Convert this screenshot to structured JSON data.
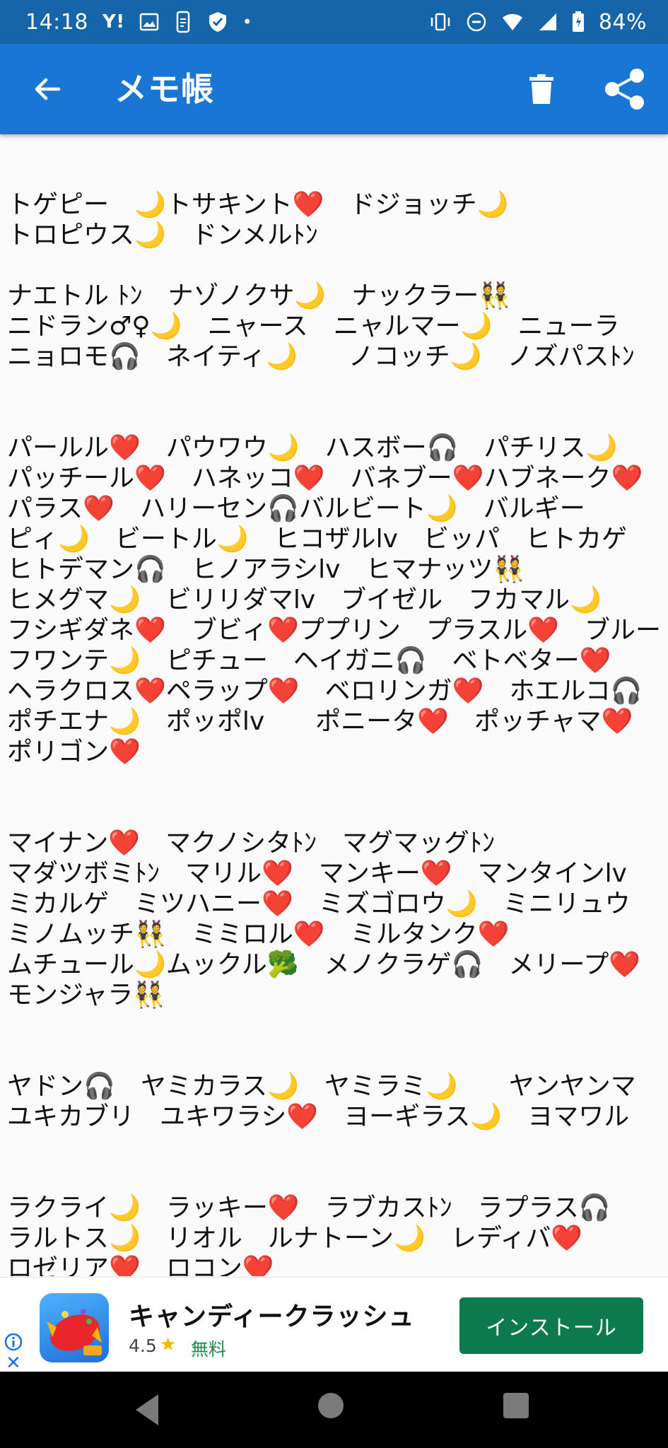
{
  "status_bar": {
    "time": "14:18",
    "yahoo": "Y!",
    "dot": "•",
    "battery": "84%"
  },
  "app_bar": {
    "title": "メモ帳"
  },
  "memo": {
    "text": "トゲピー　🌙トサキント❤️　ドジョッチ🌙\nトロピウス🌙　ドンメルﾄﾝ\n\nナエトル ﾄﾝ　ナゾノクサ🌙　ナックラー👯\nニドラン♂♀🌙　ニャース　ニャルマー🌙　ニューラ\nニョロモ🎧　ネイティ🌙　　ノコッチ🌙　ノズパスﾄﾝ\n\n\nパールル❤️　パウワウ🌙　ハスボー🎧　パチリス🌙\nパッチール❤️　ハネッコ❤️　バネブー❤️ハブネーク❤️\nパラス❤️　ハリーセン🎧バルビート🌙　バルギー\nピィ🌙　ビートル🌙　ヒコザルlv　ビッパ　ヒトカゲ\nヒトデマン🎧　ヒノアラシlv　ヒマナッツ👯\nヒメグマ🌙　ビリリダマlv　ブイゼル　フカマル🌙\nフシギダネ❤️　ブビィ❤️ププリン　プラスル❤️　ブルー\nフワンテ🌙　ピチュー　ヘイガニ🎧　ベトベター❤️\nヘラクロス❤️ペラップ❤️　ベロリンガ❤️　ホエルコ🎧\nポチエナ🌙　ポッポlv　　ポニータ❤️　ポッチャマ❤️\nポリゴン❤️\n\n\nマイナン❤️　マクノシタﾄﾝ　マグマッグﾄﾝ\nマダツボミﾄﾝ　マリル❤️　マンキー❤️　マンタインlv\nミカルゲ　ミツハニー❤️　ミズゴロウ🌙　ミニリュウ\nミノムッチ👯　ミミロル❤️　ミルタンク❤️\nムチュール🌙ムックル🥦　メノクラゲ🎧　メリープ❤️\nモンジャラ👯\n\n\nヤドン🎧　ヤミカラス🌙　ヤミラミ🌙　　ヤンヤンマ\nユキカブリ　ユキワラシ❤️　ヨーギラス🌙　ヨマワル\n\n\nラクライ🌙　ラッキー❤️　ラブカスﾄﾝ　ラプラス🎧\nラルトス🌙　リオル　ルナトーン🌙　レディバ❤️\nロゼリア❤️　ロコン❤️\n\nワニノコ🎧"
  },
  "ad": {
    "app_name": "キャンディークラッシュ",
    "rating": "4.5",
    "price": "無料",
    "install_label": "インストール",
    "close_symbol": "✕"
  },
  "colors": {
    "status_bar": "#1565a8",
    "app_bar": "#1976d2",
    "install_button": "#0c7a4c"
  }
}
